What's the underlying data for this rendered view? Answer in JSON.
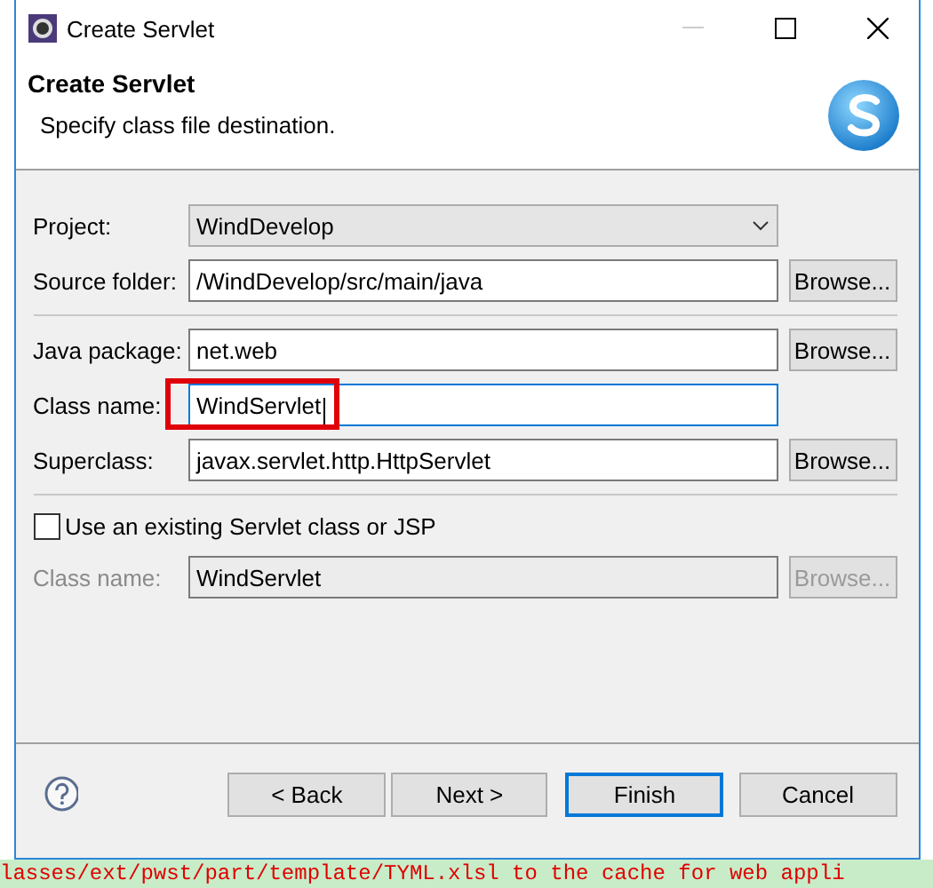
{
  "window": {
    "title": "Create Servlet"
  },
  "header": {
    "title": "Create Servlet",
    "description": "Specify class file destination."
  },
  "groups": [
    {
      "rows": [
        {
          "kind": "combo",
          "label": "Project:",
          "value": "WindDevelop",
          "disabled": false,
          "highlighted": false
        },
        {
          "kind": "text",
          "label": "Source folder:",
          "value": "/WindDevelop/src/main/java",
          "button": "Browse...",
          "disabled": false,
          "highlighted": false
        }
      ]
    },
    {
      "rows": [
        {
          "kind": "text",
          "label": "Java package:",
          "value": "net.web",
          "button": "Browse...",
          "disabled": false,
          "highlighted": false
        },
        {
          "kind": "text",
          "label": "Class name:",
          "value": "WindServlet",
          "disabled": false,
          "highlighted": true,
          "focused": true
        },
        {
          "kind": "text",
          "label": "Superclass:",
          "value": "javax.servlet.http.HttpServlet",
          "button": "Browse...",
          "disabled": false,
          "highlighted": false
        }
      ]
    },
    {
      "rows": [
        {
          "kind": "checkbox",
          "label": "Use an existing Servlet class or JSP",
          "checked": false
        },
        {
          "kind": "text",
          "label": "Class name:",
          "value": "WindServlet",
          "button": "Browse...",
          "disabled": true,
          "highlighted": false
        }
      ]
    }
  ],
  "buttons": [
    {
      "label": "< Back",
      "default": false
    },
    {
      "label": "Next >",
      "default": false
    },
    {
      "label": "Finish",
      "default": true
    },
    {
      "label": "Cancel",
      "default": false
    }
  ],
  "console_line": "lasses/ext/pwst/part/template/TYML.xlsl to the cache for web appli"
}
